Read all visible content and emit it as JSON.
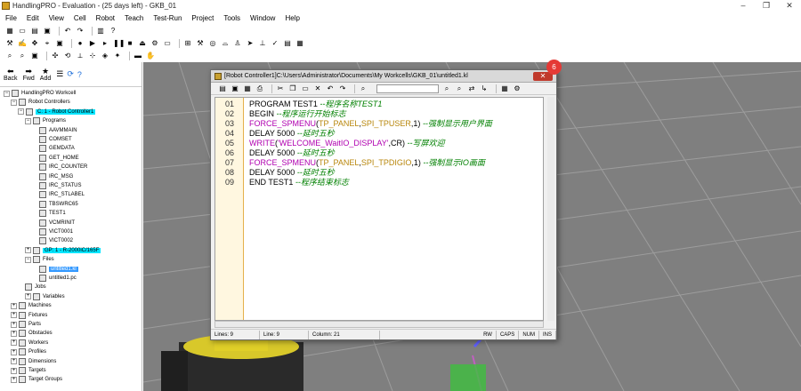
{
  "window": {
    "title": "HandlingPRO - Evaluation - (25 days left) - GKB_01"
  },
  "menu": [
    "File",
    "Edit",
    "View",
    "Cell",
    "Robot",
    "Teach",
    "Test-Run",
    "Project",
    "Tools",
    "Window",
    "Help"
  ],
  "nav": {
    "back": "Back",
    "fwd": "Fwd",
    "add": "Add"
  },
  "tree": {
    "workcell": "HandlingPRO Workcell",
    "robot_controllers": "Robot Controllers",
    "controller": "C: 1 - Robot Controller1",
    "programs": "Programs",
    "program_items": [
      "AAVMMAIN",
      "COMSET",
      "GEMDATA",
      "GET_HOME",
      "IRC_COUNTER",
      "IRC_MSG",
      "IRC_STATUS",
      "IRC_STLABEL",
      "TBSWRC65",
      "TEST1",
      "VCMRINIT",
      "VICT0001",
      "VICT0002"
    ],
    "group": "GP: 1 - R-2000iC/165F",
    "files": "Files",
    "file_items": [
      "untitled1.kl",
      "untitled1.pc"
    ],
    "jobs": "Jobs",
    "variables": "Variables",
    "others": [
      "Machines",
      "Fixtures",
      "Parts",
      "Obstacles",
      "Workers",
      "Profiles",
      "Dimensions",
      "Targets",
      "Target Groups"
    ]
  },
  "editor": {
    "title": "[Robot Controller1]C:\\Users\\Administrator\\Documents\\My Workcells\\GKB_01\\untitled1.kl",
    "badge": "6",
    "lines": [
      {
        "n": "01",
        "segs": [
          [
            "kw",
            "PROGRAM TEST1  "
          ],
          [
            "cmt",
            "--程序名称TEST1"
          ]
        ]
      },
      {
        "n": "02",
        "segs": [
          [
            "kw",
            "BEGIN  "
          ],
          [
            "cmt",
            "--程序运行开始标志"
          ]
        ]
      },
      {
        "n": "03",
        "segs": [
          [
            "kw",
            "   "
          ],
          [
            "fn",
            "FORCE_SPMENU"
          ],
          [
            "kw",
            "("
          ],
          [
            "arg",
            "TP_PANEL"
          ],
          [
            "kw",
            ","
          ],
          [
            "arg",
            "SPI_TPUSER"
          ],
          [
            "kw",
            ",1)  "
          ],
          [
            "cmt",
            "--强制显示用户界面"
          ]
        ]
      },
      {
        "n": "04",
        "segs": [
          [
            "kw",
            "    DELAY 5000  "
          ],
          [
            "cmt",
            "--延时五秒"
          ]
        ]
      },
      {
        "n": "05",
        "segs": [
          [
            "kw",
            "   "
          ],
          [
            "fn",
            "WRITE"
          ],
          [
            "kw",
            "("
          ],
          [
            "str",
            "'WELCOME_WaitIO_DISPLAY'"
          ],
          [
            "kw",
            ",CR)  "
          ],
          [
            "cmt",
            "--写屏欢迎"
          ]
        ]
      },
      {
        "n": "06",
        "segs": [
          [
            "kw",
            "   DELAY 5000  "
          ],
          [
            "cmt",
            "--延时五秒"
          ]
        ]
      },
      {
        "n": "07",
        "segs": [
          [
            "kw",
            "   "
          ],
          [
            "fn",
            "FORCE_SPMENU"
          ],
          [
            "kw",
            "("
          ],
          [
            "arg",
            "TP_PANEL"
          ],
          [
            "kw",
            ","
          ],
          [
            "arg",
            "SPI_TPDIGIO"
          ],
          [
            "kw",
            ",1)  "
          ],
          [
            "cmt",
            "--强制显示IO画面"
          ]
        ]
      },
      {
        "n": "08",
        "segs": [
          [
            "kw",
            "    DELAY 5000  "
          ],
          [
            "cmt",
            "--延时五秒"
          ]
        ]
      },
      {
        "n": "09",
        "segs": [
          [
            "kw",
            "END TEST1  "
          ],
          [
            "cmt",
            "--程序结束标志"
          ]
        ]
      }
    ],
    "status": {
      "lines": "Lines: 9",
      "line": "Line: 9",
      "column": "Column: 21",
      "rw": "RW",
      "caps": "CAPS",
      "num": "NUM",
      "ins": "INS"
    }
  },
  "colors": {
    "workspace": "#7f7f7f",
    "comment": "#008000",
    "function": "#b000b0",
    "arg": "#b8860b",
    "highlight": "#00e5ff"
  }
}
